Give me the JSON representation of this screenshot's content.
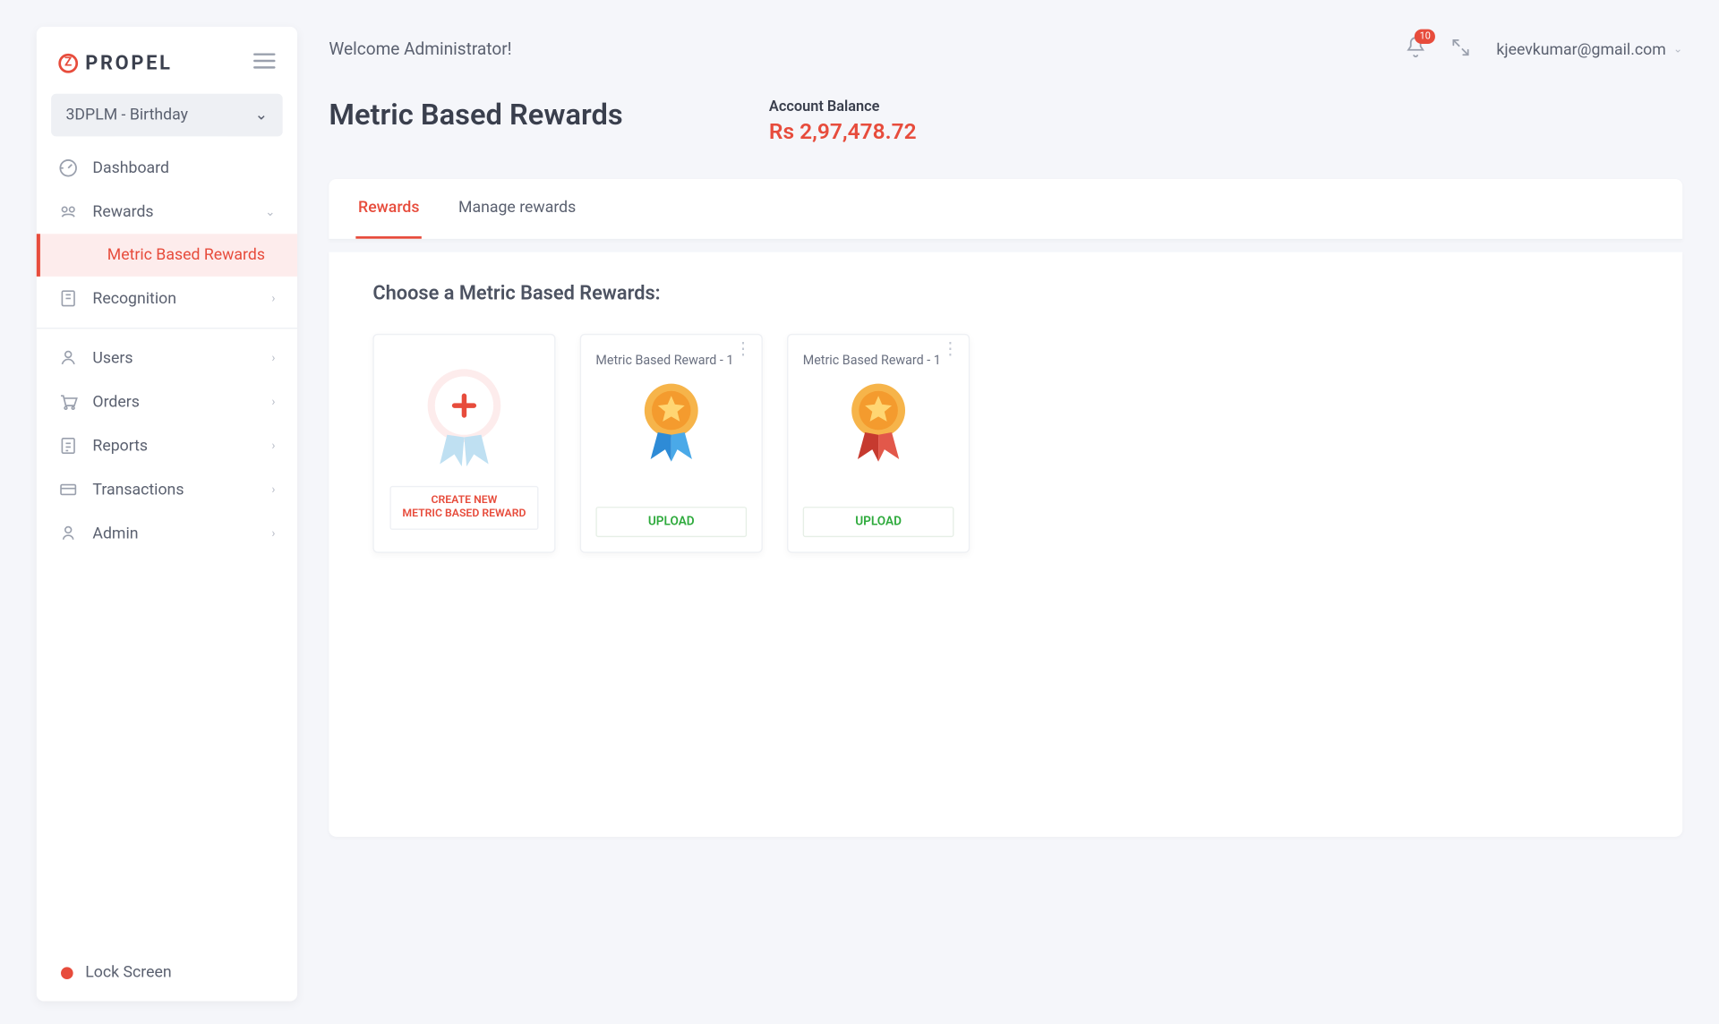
{
  "brand": {
    "logo_letter": "Z",
    "name": "PROPEL"
  },
  "program_selector": {
    "label": "3DPLM - Birthday"
  },
  "sidebar": {
    "items": {
      "dashboard": {
        "label": "Dashboard"
      },
      "rewards": {
        "label": "Rewards"
      },
      "metric_based": {
        "label": "Metric Based Rewards"
      },
      "recognition": {
        "label": "Recognition"
      },
      "users": {
        "label": "Users"
      },
      "orders": {
        "label": "Orders"
      },
      "reports": {
        "label": "Reports"
      },
      "transactions": {
        "label": "Transactions"
      },
      "admin": {
        "label": "Admin"
      }
    },
    "lock_screen": {
      "label": "Lock Screen"
    }
  },
  "header": {
    "welcome": "Welcome Administrator!",
    "notifications_count": "10",
    "user_email": "kjeevkumar@gmail.com"
  },
  "page": {
    "title": "Metric Based Rewards",
    "balance_label": "Account Balance",
    "balance_value": "Rs 2,97,478.72"
  },
  "tabs": {
    "rewards": "Rewards",
    "manage": "Manage rewards"
  },
  "panel": {
    "heading": "Choose a Metric Based Rewards:",
    "create_label": "CREATE NEW\nMETRIC BASED REWARD",
    "upload_label": "UPLOAD",
    "cards": [
      {
        "title": "Metric Based Reward - 1",
        "ribbon": "blue"
      },
      {
        "title": "Metric Based Reward - 1",
        "ribbon": "red"
      }
    ]
  }
}
